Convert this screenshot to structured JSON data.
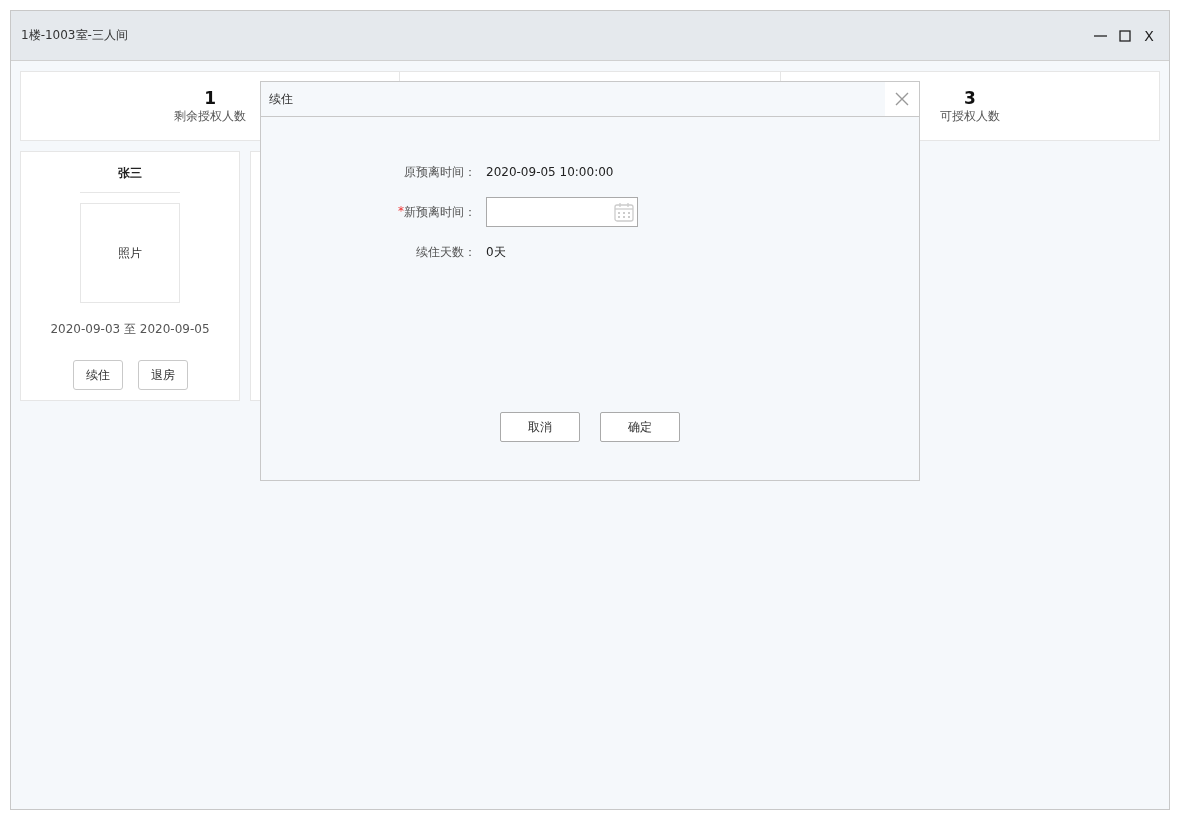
{
  "window": {
    "title": "1楼-1003室-三人间",
    "close_label": "X"
  },
  "stats": [
    {
      "value": "1",
      "label": "剩余授权人数"
    },
    {
      "value": "3",
      "label": "可授权人数"
    }
  ],
  "guests": [
    {
      "name": "张三",
      "photo": "照片",
      "dates": "2020-09-03 至 2020-09-05",
      "buttons": [
        "续住",
        "退房"
      ]
    },
    {
      "kind": "hidden"
    }
  ],
  "dialog": {
    "title": "续住",
    "fields": [
      {
        "kind": "text",
        "label": "原预离时间：",
        "value": "2020-09-05 10:00:00"
      },
      {
        "kind": "date",
        "label": "新预离时间：",
        "mark": "*"
      },
      {
        "kind": "text",
        "label": "续住天数：",
        "value": "0天"
      }
    ],
    "buttons": [
      "取消",
      "确定"
    ]
  }
}
